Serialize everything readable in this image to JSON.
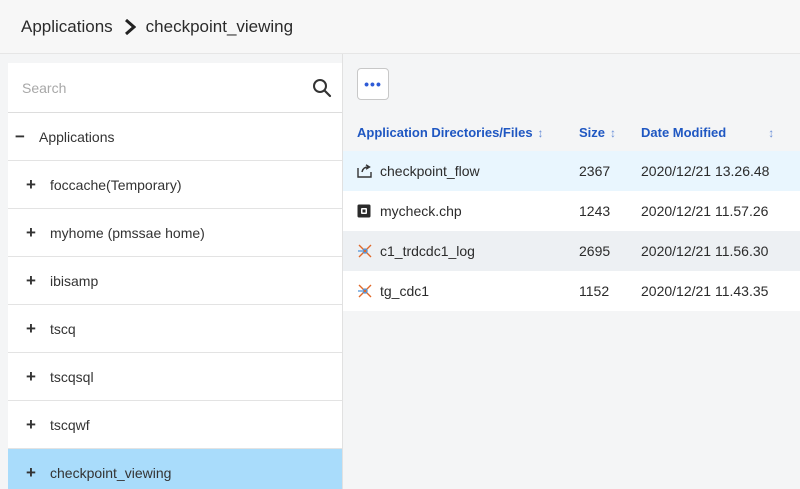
{
  "breadcrumb": {
    "root": "Applications",
    "current": "checkpoint_viewing"
  },
  "search": {
    "placeholder": "Search",
    "value": ""
  },
  "toolbar": {
    "more_label": "•••"
  },
  "tree": {
    "root": {
      "sign": "−",
      "label": "Applications"
    },
    "children": [
      {
        "sign": "+",
        "label": "foccache(Temporary)"
      },
      {
        "sign": "+",
        "label": "myhome (pmssae home)"
      },
      {
        "sign": "+",
        "label": "ibisamp"
      },
      {
        "sign": "+",
        "label": "tscq"
      },
      {
        "sign": "+",
        "label": "tscqsql"
      },
      {
        "sign": "+",
        "label": "tscqwf"
      },
      {
        "sign": "+",
        "label": "checkpoint_viewing"
      }
    ]
  },
  "table": {
    "columns": [
      {
        "label": "Application Directories/Files",
        "sort": "↕"
      },
      {
        "label": "Size",
        "sort": "↕"
      },
      {
        "label": "Date Modified",
        "sort": "↕"
      }
    ],
    "rows": [
      {
        "icon": "flow-icon",
        "name": "checkpoint_flow",
        "size": "2367",
        "date": "2020/12/21 13.26.48"
      },
      {
        "icon": "chp-file-icon",
        "name": "mycheck.chp",
        "size": "1243",
        "date": "2020/12/21 11.57.26"
      },
      {
        "icon": "synonym-icon",
        "name": "c1_trdcdc1_log",
        "size": "2695",
        "date": "2020/12/21 11.56.30"
      },
      {
        "icon": "synonym-icon",
        "name": "tg_cdc1",
        "size": "1152",
        "date": "2020/12/21 11.43.35"
      }
    ]
  },
  "colors": {
    "accent": "#1f57c2",
    "selected_tree_bg": "#a9dcfb",
    "first_row_bg": "#e9f6fe",
    "synonym_icon": "#e0692a",
    "synonym_icon_secondary": "#4a8fd6"
  }
}
